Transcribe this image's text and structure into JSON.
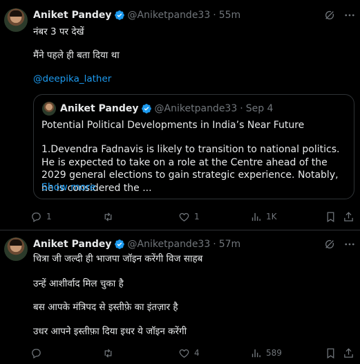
{
  "tweets": [
    {
      "name": "Aniket Pandey",
      "handle": "@Aniketpande33",
      "time": "55m",
      "lines": [
        "नंबर 3 पर देखें",
        "मैंने पहले ही बता दिया था"
      ],
      "mention": "@deepika_lather",
      "quote": {
        "name": "Aniket Pandey",
        "handle": "@Aniketpande33",
        "time": "Sep 4",
        "title": "Potential Political Developments in India’s Near Future",
        "body": "1.Devendra Fadnavis is likely to transition to national politics. He is expected to take on a role at the Centre ahead of the 2029 general elections to gain strategic experience. Notably, he is considered the ...",
        "show_more": "Show more"
      },
      "actions": {
        "replies": "1",
        "retweets": "",
        "likes": "1",
        "views": "1K"
      }
    },
    {
      "name": "Aniket Pandey",
      "handle": "@Aniketpande33",
      "time": "57m",
      "lines": [
        "चित्रा जी जल्दी ही भाजपा जॉइन करेंगी विज साहब",
        "उन्हें आशीर्वाद मिल चुका है",
        "बस आपके मंत्रिपद से इस्तीफ़े का इंतज़ार है",
        "उधर आपने इस्तीफ़ा दिया इधर ये जॉइन करेंगी"
      ],
      "actions": {
        "replies": "",
        "retweets": "",
        "likes": "4",
        "views": "589"
      }
    }
  ],
  "icons": {
    "verified": "verified-badge-icon",
    "grok": "grok-icon",
    "more": "more-icon",
    "reply": "reply-icon",
    "retweet": "retweet-icon",
    "like": "like-icon",
    "views": "views-icon",
    "bookmark": "bookmark-icon",
    "share": "share-icon"
  },
  "colors": {
    "background": "#000000",
    "text": "#e7e9ea",
    "muted": "#71767b",
    "accent": "#1d9bf0",
    "border": "#2f3336"
  }
}
